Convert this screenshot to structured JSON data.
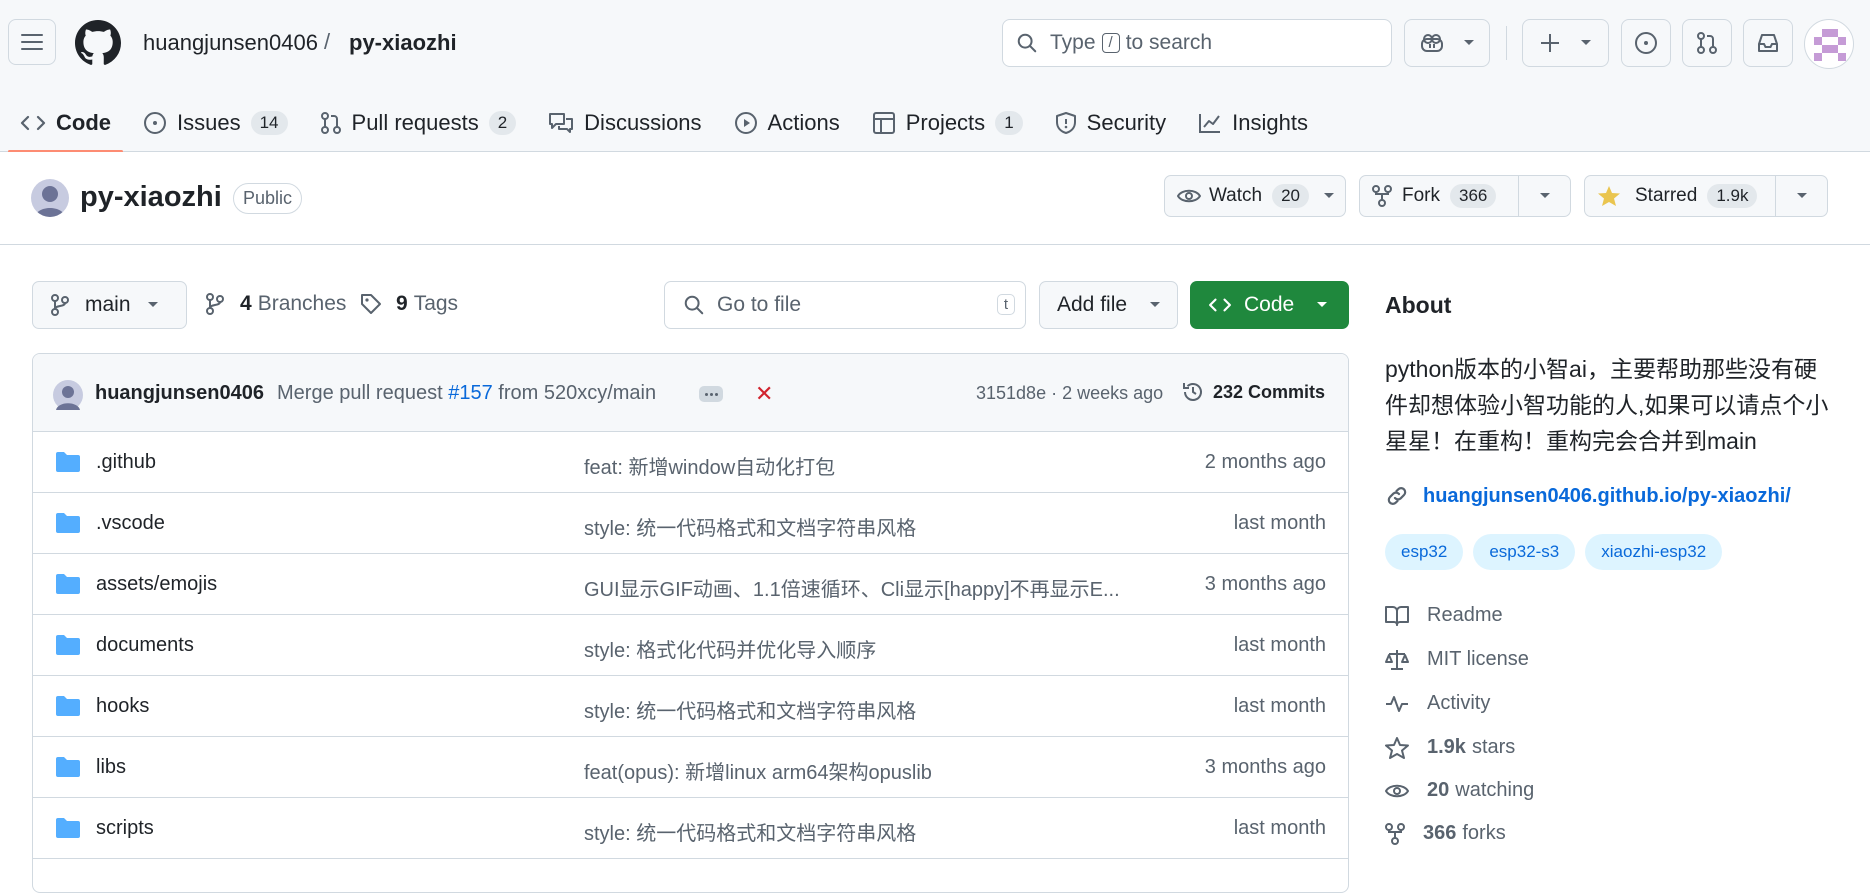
{
  "header": {
    "owner": "huangjunsen0406",
    "separator": "/",
    "repo": "py-xiaozhi",
    "search_prefix": "Type",
    "search_key": "/",
    "search_suffix": "to search"
  },
  "tabs": [
    {
      "label": "Code",
      "count": ""
    },
    {
      "label": "Issues",
      "count": "14"
    },
    {
      "label": "Pull requests",
      "count": "2"
    },
    {
      "label": "Discussions",
      "count": ""
    },
    {
      "label": "Actions",
      "count": ""
    },
    {
      "label": "Projects",
      "count": "1"
    },
    {
      "label": "Security",
      "count": ""
    },
    {
      "label": "Insights",
      "count": ""
    }
  ],
  "repo": {
    "name": "py-xiaozhi",
    "visibility": "Public",
    "watch_label": "Watch",
    "watch_count": "20",
    "fork_label": "Fork",
    "fork_count": "366",
    "star_label": "Starred",
    "star_count": "1.9k"
  },
  "toolbar": {
    "branch": "main",
    "branches_count": "4",
    "branches_label": "Branches",
    "tags_count": "9",
    "tags_label": "Tags",
    "goto_placeholder": "Go to file",
    "goto_key": "t",
    "add_file": "Add file",
    "code": "Code"
  },
  "commit": {
    "author": "huangjunsen0406",
    "msg_prefix": "Merge pull request",
    "pr": "#157",
    "msg_suffix": "from 520xcy/main",
    "status": "✕",
    "hash_time": "3151d8e · 2 weeks ago",
    "commits": "232 Commits"
  },
  "files": [
    {
      "name": ".github",
      "msg": "feat: 新增window自动化打包",
      "date": "2 months ago"
    },
    {
      "name": ".vscode",
      "msg": "style: 统一代码格式和文档字符串风格",
      "date": "last month"
    },
    {
      "name": "assets/emojis",
      "msg": "GUI显示GIF动画、1.1倍速循环、Cli显示[happy]不再显示E...",
      "date": "3 months ago"
    },
    {
      "name": "documents",
      "msg": "style: 格式化代码并优化导入顺序",
      "date": "last month"
    },
    {
      "name": "hooks",
      "msg": "style: 统一代码格式和文档字符串风格",
      "date": "last month"
    },
    {
      "name": "libs",
      "msg": "feat(opus): 新增linux arm64架构opuslib",
      "date": "3 months ago"
    },
    {
      "name": "scripts",
      "msg": "style: 统一代码格式和文档字符串风格",
      "date": "last month"
    }
  ],
  "about": {
    "title": "About",
    "description": "python版本的小智ai，主要帮助那些没有硬件却想体验小智功能的人,如果可以请点个小星星！在重构！重构完会合并到main",
    "link": "huangjunsen0406.github.io/py-xiaozhi/",
    "topics": [
      "esp32",
      "esp32-s3",
      "xiaozhi-esp32"
    ],
    "readme": "Readme",
    "license": "MIT license",
    "activity": "Activity",
    "stars_count": "1.9k",
    "stars_label": "stars",
    "watching_count": "20",
    "watching_label": "watching",
    "forks_count": "366",
    "forks_label": "forks"
  },
  "colors": {
    "accent_green": "#1f883d",
    "link_blue": "#0969da",
    "tab_underline": "#fd8c73",
    "folder": "#54aeff",
    "star": "#eac54f",
    "error_red": "#d1242f"
  }
}
